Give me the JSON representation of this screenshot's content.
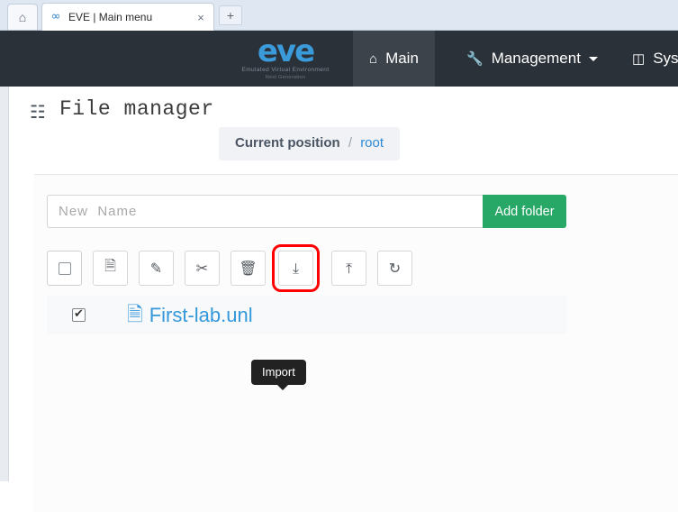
{
  "browser": {
    "home_icon": "home-icon",
    "tab": {
      "favicon": "eve-infinity-icon",
      "title": "EVE | Main menu",
      "close": "×"
    },
    "new_tab": "+"
  },
  "navbar": {
    "brand": {
      "logo": "eve",
      "sub1": "Emulated Virtual Environment",
      "sub2": "Next Generation"
    },
    "items": [
      {
        "id": "main",
        "label": "Main",
        "icon": "home-icon",
        "active": true,
        "caret": false
      },
      {
        "id": "management",
        "label": "Management",
        "icon": "wrench-icon",
        "active": false,
        "caret": true
      },
      {
        "id": "system",
        "label": "Syst",
        "icon": "server-icon",
        "active": false,
        "caret": false
      }
    ]
  },
  "header": {
    "icon": "sitemap-icon",
    "title": "File manager",
    "position_label": "Current position",
    "position_separator": "/",
    "position_value": "root"
  },
  "form": {
    "new_name_placeholder": "New  Name",
    "new_name_value": "",
    "add_folder_label": "Add folder"
  },
  "toolbar": {
    "tooltip": "Import",
    "buttons": [
      {
        "id": "select-all",
        "name": "select-all-checkbox",
        "glyph": "",
        "title": "Select all"
      },
      {
        "id": "new-file",
        "name": "new-file-button",
        "glyph": "",
        "title": "New file"
      },
      {
        "id": "rename",
        "name": "edit-rename-button",
        "glyph": "✎",
        "title": "Rename"
      },
      {
        "id": "cut",
        "name": "cut-button",
        "glyph": "✂",
        "title": "Cut"
      },
      {
        "id": "delete",
        "name": "delete-button",
        "glyph": "",
        "title": "Delete"
      },
      {
        "id": "import",
        "name": "import-button",
        "glyph": "⤓",
        "title": "Import",
        "highlighted": true
      },
      {
        "id": "export",
        "name": "export-button",
        "glyph": "⤒",
        "title": "Export"
      },
      {
        "id": "refresh",
        "name": "refresh-button",
        "glyph": "↻",
        "title": "Refresh"
      }
    ]
  },
  "files": {
    "rows": [
      {
        "checked": true,
        "icon": "file-icon",
        "name": "First-lab.unl"
      }
    ]
  },
  "colors": {
    "navbar_bg": "#2b3138",
    "nav_active_bg": "#3c434b",
    "brand_blue": "#3b9ad9",
    "link_blue": "#3498db",
    "green": "#28a867",
    "highlight_red": "#ff0000"
  }
}
